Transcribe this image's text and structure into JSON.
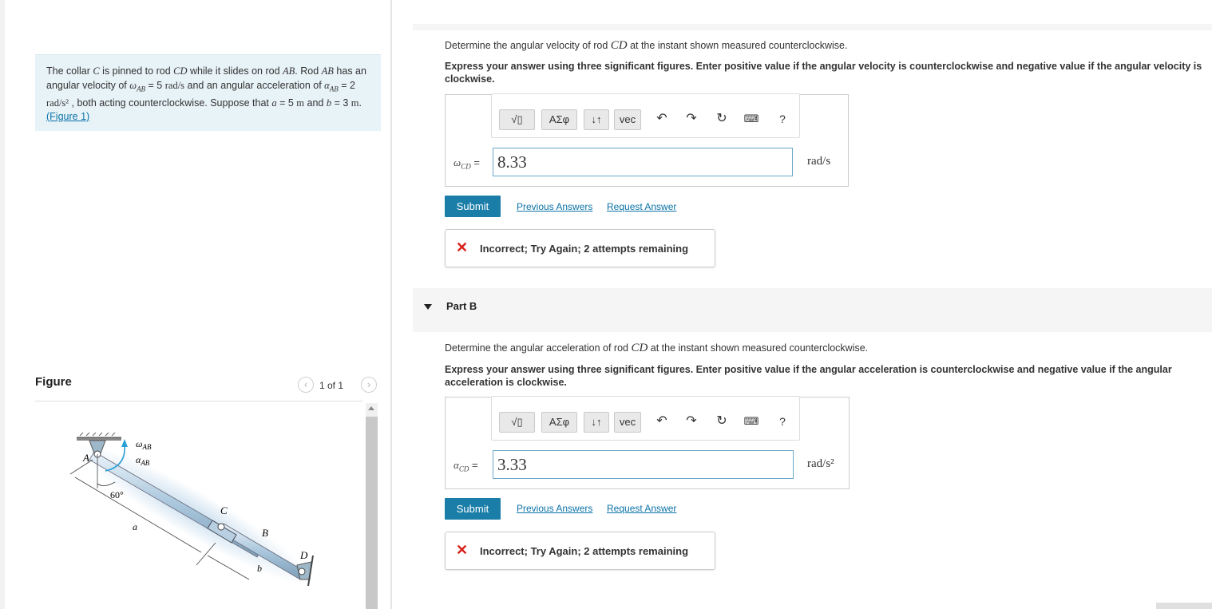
{
  "problem": {
    "text1": "The collar ",
    "var_c": "C",
    "text2": " is pinned to rod ",
    "var_cd": "CD",
    "text3": " while it slides on rod ",
    "var_ab": "AB",
    "text4": ". Rod ",
    "var_ab2": "AB",
    "text5": " has an angular velocity of ",
    "omega_ab": "ω",
    "omega_sub": "AB",
    "text6": " = 5 ",
    "unit_rads": "rad/s",
    "text7": " and an angular acceleration of ",
    "alpha_ab": "α",
    "alpha_sub": "AB",
    "text8": " = 2 ",
    "unit_rads2": "rad/s²",
    "text9": " , both acting counterclockwise. Suppose that ",
    "var_a": "a",
    "text10": " = 5 ",
    "unit_m1": "m",
    "text11": " and ",
    "var_b": "b",
    "text12": " = 3 ",
    "unit_m2": "m",
    "text13": ". ",
    "figure_link": "(Figure 1)"
  },
  "figure": {
    "label": "Figure",
    "pager_text": "1 of 1",
    "labels": {
      "A": "A",
      "B": "B",
      "C": "C",
      "D": "D",
      "a": "a",
      "b": "b",
      "angle": "60°",
      "omega": "ω",
      "omega_sub": "AB",
      "alpha": "α",
      "alpha_sub": "AB"
    }
  },
  "part_a": {
    "prompt_pre": "Determine the angular velocity of rod ",
    "prompt_var": "CD",
    "prompt_post": " at the instant shown measured counterclockwise.",
    "instructions": "Express your answer using three significant figures. Enter positive value if the angular velocity is counterclockwise and negative value if the angular velocity is clockwise.",
    "var_symbol": "ω",
    "var_sub": "CD",
    "equals": " =",
    "answer_value": "8.33",
    "unit": "rad/s",
    "submit_label": "Submit",
    "previous_answers": "Previous Answers",
    "request_answer": "Request Answer",
    "feedback": "Incorrect; Try Again; 2 attempts remaining"
  },
  "part_b": {
    "title": "Part B",
    "prompt_pre": "Determine the angular acceleration of rod ",
    "prompt_var": "CD",
    "prompt_post": " at the instant shown measured counterclockwise.",
    "instructions": "Express your answer using three significant figures. Enter positive value if the angular acceleration is counterclockwise and negative value if the angular acceleration is clockwise.",
    "var_symbol": "α",
    "var_sub": "CD",
    "equals": " =",
    "answer_value": "3.33",
    "unit": "rad/s²",
    "submit_label": "Submit",
    "previous_answers": "Previous Answers",
    "request_answer": "Request Answer",
    "feedback": "Incorrect; Try Again; 2 attempts remaining"
  },
  "toolbar": {
    "templates_label": "√▯",
    "greek_label": "ΑΣφ",
    "arrows_label": "↓↑",
    "vec_label": "vec",
    "help_label": "?"
  },
  "colors": {
    "accent": "#1a7ea8",
    "link": "#0b72a8",
    "error": "#d9201a",
    "problem_bg": "#e8f3f7"
  }
}
